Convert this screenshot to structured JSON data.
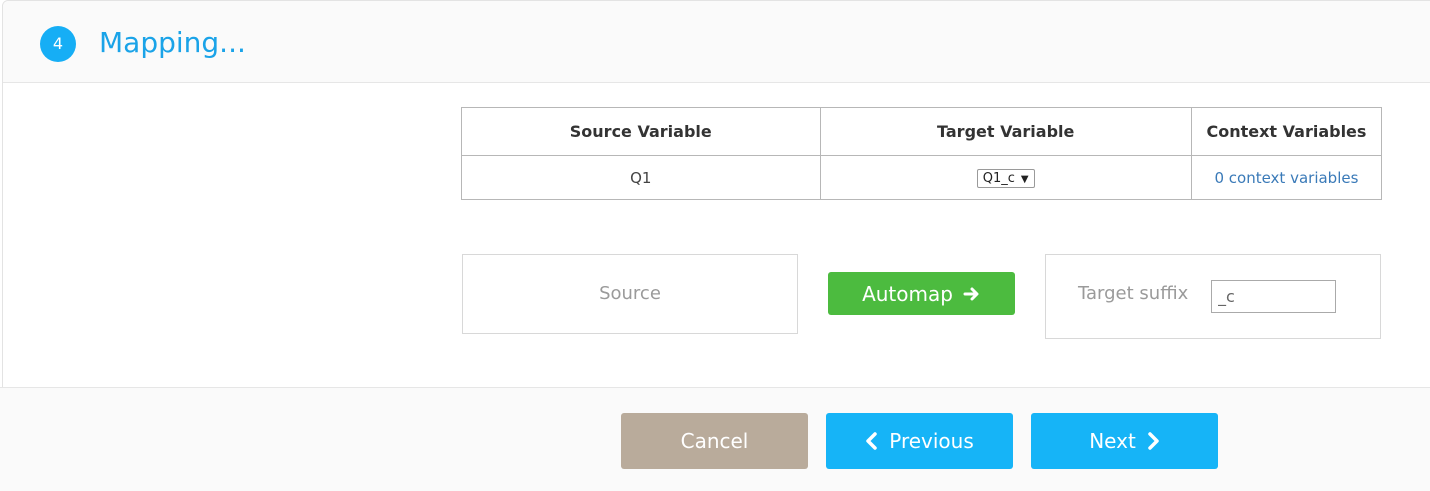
{
  "header": {
    "step_number": "4",
    "title": "Mapping..."
  },
  "table": {
    "columns": [
      "Source Variable",
      "Target Variable",
      "Context Variables"
    ],
    "rows": [
      {
        "source": "Q1",
        "target": "Q1_c",
        "context": "0 context variables"
      }
    ]
  },
  "mapping_controls": {
    "source_label": "Source",
    "automap_label": "Automap",
    "target_suffix_label": "Target suffix",
    "target_suffix_value": "_c"
  },
  "footer": {
    "cancel_label": "Cancel",
    "previous_label": "Previous",
    "next_label": "Next"
  },
  "colors": {
    "accent": "#16aef5",
    "automap": "#4cbb3f",
    "cancel": "#b9ab9b",
    "link": "#3a7ab8"
  },
  "icons": {
    "automap": "arrow-right-icon",
    "previous": "chevron-left-icon",
    "next": "chevron-right-icon",
    "select": "caret-down-icon"
  }
}
